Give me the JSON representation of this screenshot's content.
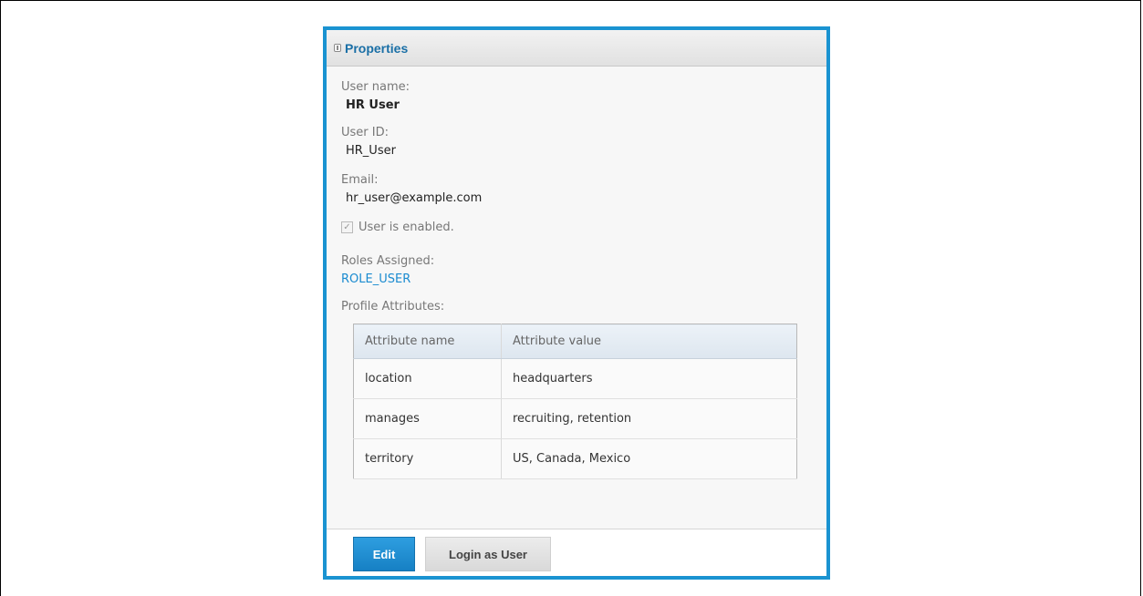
{
  "panel": {
    "title": "Properties",
    "collapse_icon": "collapse-icon"
  },
  "user": {
    "name_label": "User name:",
    "name_value": "HR User",
    "id_label": "User ID:",
    "id_value": "HR_User",
    "email_label": "Email:",
    "email_value": "hr_user@example.com",
    "enabled_label": "User is enabled.",
    "enabled": true
  },
  "roles": {
    "label": "Roles Assigned:",
    "items": [
      "ROLE_USER"
    ]
  },
  "profile": {
    "label": "Profile Attributes:",
    "columns": [
      "Attribute name",
      "Attribute value"
    ],
    "rows": [
      [
        "location",
        "headquarters"
      ],
      [
        "manages",
        "recruiting, retention"
      ],
      [
        "territory",
        "US, Canada, Mexico"
      ]
    ]
  },
  "actions": {
    "edit_label": "Edit",
    "login_label": "Login as User"
  },
  "colors": {
    "accent": "#1a93d1",
    "link": "#1a8bd0",
    "title": "#1a6fa6"
  }
}
